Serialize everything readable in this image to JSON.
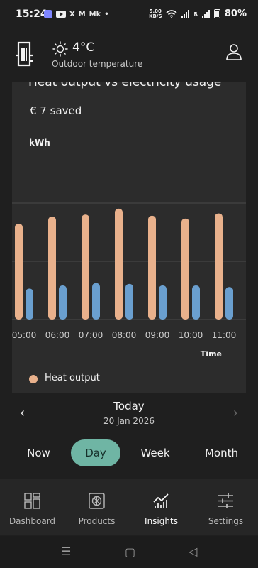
{
  "status_bar": {
    "time": "15:24",
    "net_speed_value": "5.00",
    "net_speed_unit": "KB/S",
    "roaming": "R",
    "battery": "80%",
    "app_glyphs": [
      "X",
      "M",
      "Mk"
    ]
  },
  "header": {
    "temperature": "4°C",
    "temperature_label": "Outdoor temperature",
    "icons": [
      "heat-pump-logo",
      "sun-icon",
      "profile-icon"
    ]
  },
  "card": {
    "title": "Heat output vs electricity usage",
    "saved": "€ 7 saved",
    "unit": "kWh",
    "x_axis_label": "Time",
    "legend": [
      {
        "label": "Heat output",
        "color": "#e9b18c"
      }
    ]
  },
  "chart_data": {
    "type": "bar",
    "categories": [
      "05:00",
      "06:00",
      "07:00",
      "08:00",
      "09:00",
      "10:00",
      "11:00"
    ],
    "series": [
      {
        "name": "Heat output",
        "color": "#e9b18c",
        "values": [
          2.42,
          2.6,
          2.65,
          2.8,
          2.62,
          2.55,
          2.68
        ]
      },
      {
        "color": "#6a9fcf",
        "values": [
          0.78,
          0.86,
          0.92,
          0.9,
          0.86,
          0.86,
          0.82
        ]
      }
    ],
    "ylim": [
      0,
      3.3
    ],
    "grid": true
  },
  "date_selector": {
    "title": "Today",
    "date": "20 Jan 2026",
    "ranges": [
      "Now",
      "Day",
      "Week",
      "Month"
    ],
    "active_range": "Day"
  },
  "bottom_nav": {
    "items": [
      {
        "label": "Dashboard",
        "icon": "dashboard-icon"
      },
      {
        "label": "Products",
        "icon": "products-icon"
      },
      {
        "label": "Insights",
        "icon": "insights-icon"
      },
      {
        "label": "Settings",
        "icon": "settings-icon"
      }
    ],
    "active": "Insights"
  }
}
